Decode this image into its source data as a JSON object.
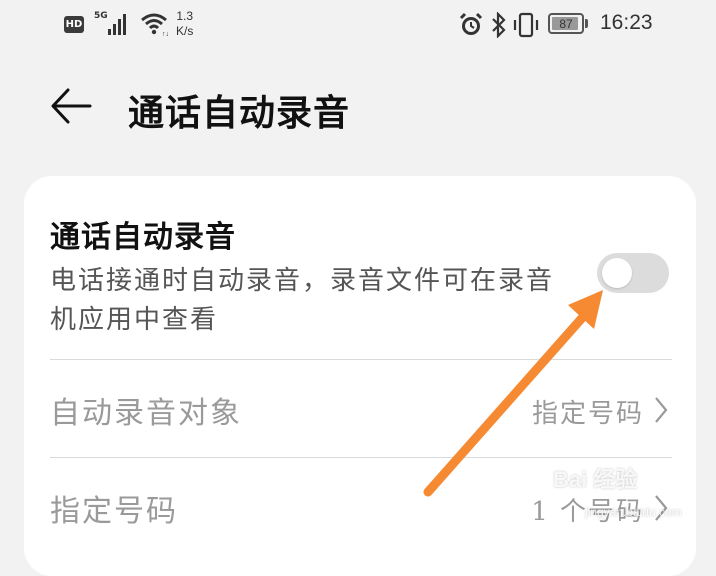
{
  "status_bar": {
    "hd_badge": "HD",
    "network_type": "5G",
    "net_speed_value": "1.3",
    "net_speed_unit": "K/s",
    "battery_level": "87",
    "time": "16:23",
    "icons": [
      "alarm-icon",
      "bluetooth-icon",
      "vibrate-icon",
      "battery-icon"
    ]
  },
  "header": {
    "title": "通话自动录音",
    "back_icon": "back-arrow-icon"
  },
  "settings": {
    "auto_record": {
      "title": "通话自动录音",
      "description": "电话接通时自动录音，录音文件可在录音机应用中查看",
      "enabled": false
    },
    "items": [
      {
        "label": "自动录音对象",
        "value": "指定号码"
      },
      {
        "label": "指定号码",
        "value": "1 个号码"
      }
    ]
  },
  "annotation": {
    "arrow_color": "#f58a33"
  },
  "watermark": {
    "text": "Bai 经验",
    "sub": "jingyan.baidu.com"
  },
  "colors": {
    "background": "#f2f2f2",
    "card": "#ffffff",
    "toggle_off": "#dcdcdc",
    "disabled_text": "#9a9a9a"
  }
}
